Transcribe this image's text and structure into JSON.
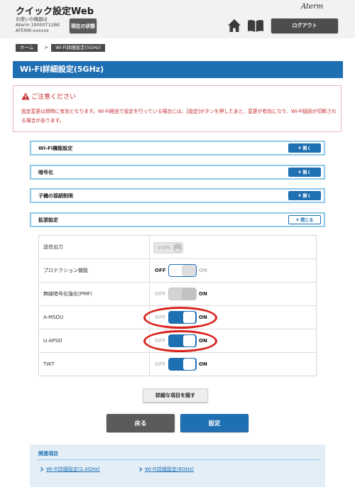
{
  "header": {
    "app_title": "クイック設定Web",
    "device_label": "お使いの機器は",
    "device_model": "Aterm 19000T12BE",
    "device_name": "ATERM-xxxxxx",
    "status_button": "現在の状態",
    "brand": "Aterm",
    "logout_button": "ログアウト"
  },
  "breadcrumb": {
    "home": "ホーム",
    "separator": ">",
    "current": "Wi-Fi詳細設定(5GHz)"
  },
  "page_title": "Wi-Fi詳細設定(5GHz)",
  "caution": {
    "title": "ご注意ください",
    "text": "設定変更は即時に有効となります。Wi-Fi経由で設定を行っている場合には、[設定]ボタンを押したあと、変更が有効になり、Wi-Fi接続が切断される場合があります。"
  },
  "sections": [
    {
      "label": "Wi-Fi機能設定",
      "button": "開く"
    },
    {
      "label": "暗号化",
      "button": "開く"
    },
    {
      "label": "子機の接続制限",
      "button": "開く"
    },
    {
      "label": "拡張設定",
      "button": "閉じる"
    }
  ],
  "settings": {
    "tx_power": {
      "label": "送信出力",
      "value": "100%"
    },
    "protection": {
      "label": "プロテクション機能",
      "off": "OFF",
      "on": "ON",
      "state": "OFF"
    },
    "pmf": {
      "label": "無線暗号化強化(PMF)",
      "off": "OFF",
      "on": "ON",
      "state": "OFF",
      "disabled": true
    },
    "amsdu": {
      "label": "A-MSDU",
      "off": "OFF",
      "on": "ON",
      "state": "ON"
    },
    "uapsd": {
      "label": "U-APSD",
      "off": "OFF",
      "on": "ON",
      "state": "ON"
    },
    "twt": {
      "label": "TWT",
      "off": "OFF",
      "on": "ON",
      "state": "ON"
    }
  },
  "buttons": {
    "detail": "詳細な項目を隠す",
    "back": "戻る",
    "set": "設定"
  },
  "related": {
    "title": "関連項目",
    "link1": "Wi-Fi詳細設定(2.4GHz)",
    "link2": "Wi-Fi詳細設定(6GHz)"
  },
  "colors": {
    "accent": "#1f6fb3",
    "section_border": "#8fc8e8",
    "caution_text": "#c6262b",
    "highlight_ellipse": "#d9221c"
  }
}
